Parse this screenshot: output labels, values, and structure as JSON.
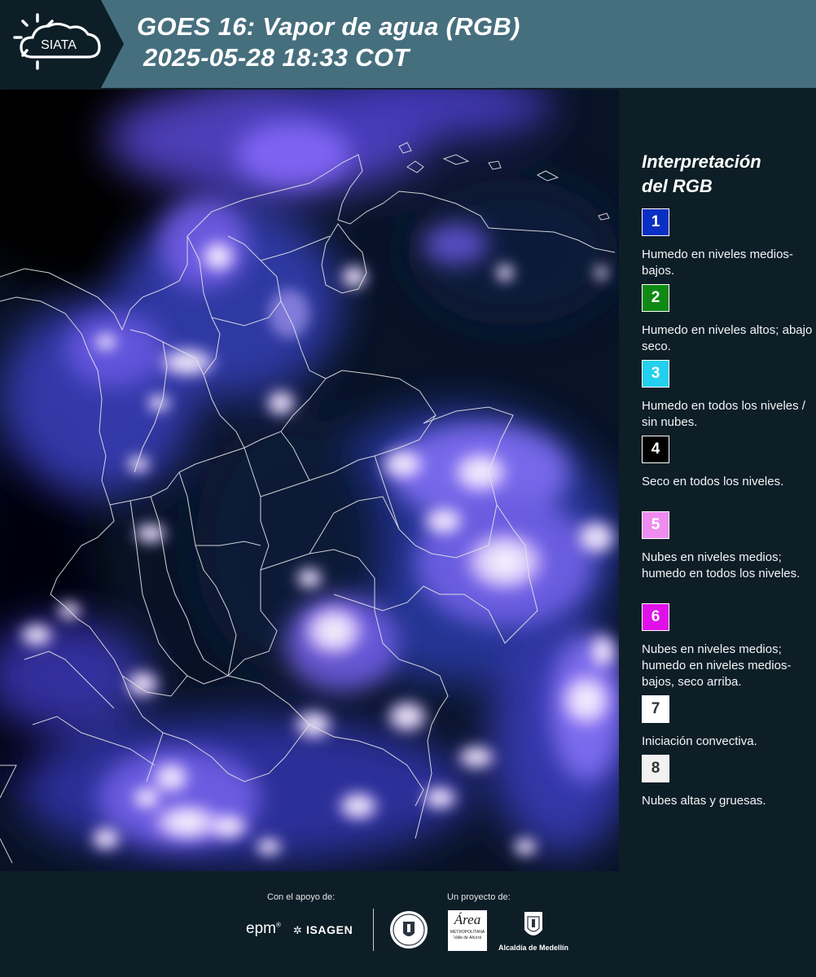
{
  "header": {
    "logo_text": "SIATA",
    "title_line1": "GOES 16: Vapor de agua (RGB)",
    "title_line2": "2025-05-28 18:33 COT"
  },
  "legend": {
    "title_line1": "Interpretación",
    "title_line2": "del RGB",
    "items": [
      {
        "number": "1",
        "color": "#0a2fc4",
        "text_color": "#ffffff",
        "description": "Humedo en niveles medios-bajos."
      },
      {
        "number": "2",
        "color": "#0e8a14",
        "text_color": "#ffffff",
        "description": "Humedo en niveles altos; abajo seco."
      },
      {
        "number": "3",
        "color": "#23d0ee",
        "text_color": "#ffffff",
        "description": "Humedo en todos los niveles / sin nubes."
      },
      {
        "number": "4",
        "color": "#000000",
        "text_color": "#ffffff",
        "description": "Seco en todos los niveles."
      },
      {
        "number": "5",
        "color": "#ef8cf0",
        "text_color": "#ffffff",
        "description": "Nubes en niveles medios; humedo en todos los niveles."
      },
      {
        "number": "6",
        "color": "#e010ea",
        "text_color": "#ffffff",
        "description": "Nubes en niveles medios; humedo en niveles medios-bajos, seco arriba."
      },
      {
        "number": "7",
        "color": "#ffffff",
        "text_color": "#333333",
        "description": "Iniciación convectiva."
      },
      {
        "number": "8",
        "color": "#f2f2f2",
        "text_color": "#333333",
        "description": "Nubes altas y gruesas."
      }
    ]
  },
  "footer": {
    "support_label": "Con el apoyo de:",
    "project_label": "Un proyecto de:",
    "epm_logo": "epm",
    "isagen_logo": "ISAGEN",
    "area_logo_main": "Área",
    "area_logo_sub1": "METROPOLITANA",
    "area_logo_sub2": "Valle de Aburrá",
    "alcaldia_logo": "Alcaldía de Medellín"
  }
}
